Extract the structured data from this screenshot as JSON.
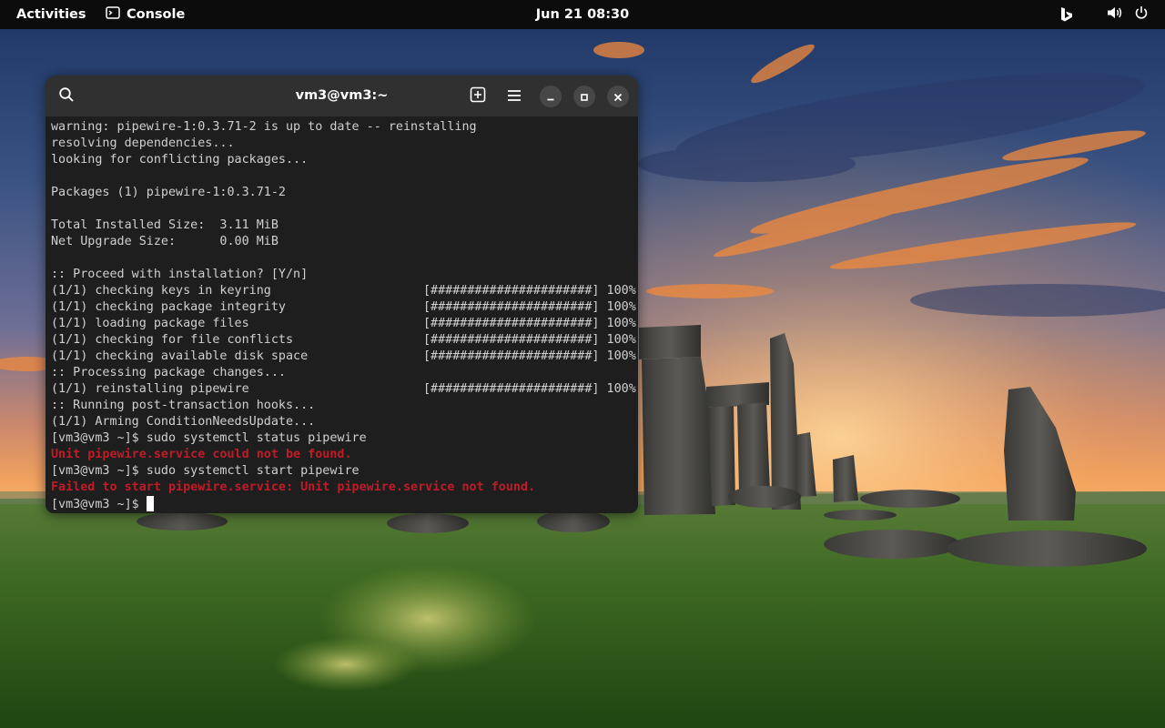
{
  "topbar": {
    "activities_label": "Activities",
    "app_name": "Console",
    "clock": "Jun 21  08:30",
    "bing_icon": "bing-logo-icon",
    "volume_icon": "speaker-volume-icon",
    "power_icon": "power-icon"
  },
  "terminal": {
    "title": "vm3@vm3:~",
    "header_icons": [
      "search-icon",
      "new-tab-icon",
      "hamburger-menu-icon",
      "minimize-icon",
      "maximize-icon",
      "close-icon"
    ],
    "lines": [
      {
        "text": "warning: pipewire-1:0.3.71-2 is up to date -- reinstalling"
      },
      {
        "text": "resolving dependencies..."
      },
      {
        "text": "looking for conflicting packages..."
      },
      {
        "text": ""
      },
      {
        "text": "Packages (1) pipewire-1:0.3.71-2"
      },
      {
        "text": ""
      },
      {
        "text": "Total Installed Size:  3.11 MiB"
      },
      {
        "text": "Net Upgrade Size:      0.00 MiB"
      },
      {
        "text": ""
      },
      {
        "text": ":: Proceed with installation? [Y/n]"
      },
      {
        "text": "(1/1) checking keys in keyring",
        "progress": "[######################] 100%"
      },
      {
        "text": "(1/1) checking package integrity",
        "progress": "[######################] 100%"
      },
      {
        "text": "(1/1) loading package files",
        "progress": "[######################] 100%"
      },
      {
        "text": "(1/1) checking for file conflicts",
        "progress": "[######################] 100%"
      },
      {
        "text": "(1/1) checking available disk space",
        "progress": "[######################] 100%"
      },
      {
        "text": ":: Processing package changes..."
      },
      {
        "text": "(1/1) reinstalling pipewire",
        "progress": "[######################] 100%"
      },
      {
        "text": ":: Running post-transaction hooks..."
      },
      {
        "text": "(1/1) Arming ConditionNeedsUpdate..."
      },
      {
        "text": "[vm3@vm3 ~]$ sudo systemctl status pipewire"
      },
      {
        "text": "Unit pipewire.service could not be found.",
        "error": true
      },
      {
        "text": "[vm3@vm3 ~]$ sudo systemctl start pipewire"
      },
      {
        "text": "Failed to start pipewire.service: Unit pipewire.service not found.",
        "error": true
      }
    ],
    "prompt": "[vm3@vm3 ~]$ ",
    "colors": {
      "background": "#1e1e1e",
      "headerbar": "#303030",
      "foreground": "#d0d0d0",
      "error": "#c01c28"
    }
  }
}
